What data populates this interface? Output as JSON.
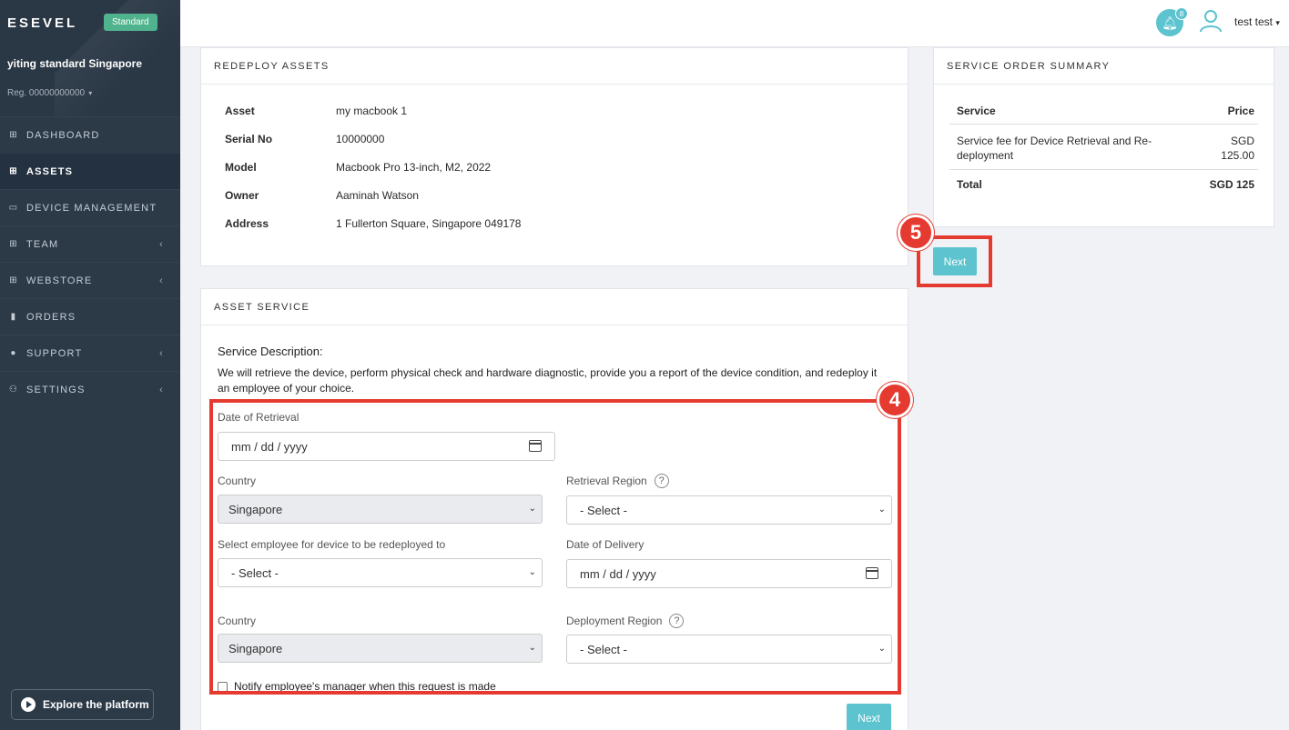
{
  "sidebar": {
    "brand": "ESEVEL",
    "plan_badge": "Standard",
    "org_name": "yiting standard Singapore",
    "org_reg": "Reg. 00000000000",
    "items": [
      {
        "label": "DASHBOARD",
        "icon": "grid-icon",
        "active": false,
        "has_chevron": false
      },
      {
        "label": "ASSETS",
        "icon": "grid-icon",
        "active": true,
        "has_chevron": false
      },
      {
        "label": "DEVICE MANAGEMENT",
        "icon": "laptop-icon",
        "active": false,
        "has_chevron": false
      },
      {
        "label": "TEAM",
        "icon": "grid-icon",
        "active": false,
        "has_chevron": true
      },
      {
        "label": "WEBSTORE",
        "icon": "grid-icon",
        "active": false,
        "has_chevron": true
      },
      {
        "label": "ORDERS",
        "icon": "document-icon",
        "active": false,
        "has_chevron": false
      },
      {
        "label": "SUPPORT",
        "icon": "info-icon",
        "active": false,
        "has_chevron": true
      },
      {
        "label": "SETTINGS",
        "icon": "users-icon",
        "active": false,
        "has_chevron": true
      }
    ],
    "explore_label": "Explore the platform"
  },
  "topbar": {
    "notification_count": "8",
    "user_name": "test test"
  },
  "redeploy": {
    "title": "REDEPLOY ASSETS",
    "rows": [
      {
        "label": "Asset",
        "value": "my macbook 1"
      },
      {
        "label": "Serial No",
        "value": "10000000"
      },
      {
        "label": "Model",
        "value": "Macbook Pro 13-inch, M2, 2022"
      },
      {
        "label": "Owner",
        "value": "Aaminah Watson"
      },
      {
        "label": "Address",
        "value": "1 Fullerton Square, Singapore 049178"
      }
    ]
  },
  "asset_service": {
    "title": "ASSET SERVICE",
    "desc_title": "Service Description:",
    "desc_text": "We will retrieve the device, perform physical check and hardware diagnostic, provide you a report of the device condition, and redeploy it an employee of your choice.",
    "date_retrieval_label": "Date of Retrieval",
    "date_retrieval_placeholder": "mm / dd / yyyy",
    "country1_label": "Country",
    "country1_value": "Singapore",
    "retrieval_region_label": "Retrieval Region",
    "retrieval_region_value": "- Select -",
    "employee_label": "Select employee for device to be redeployed to",
    "employee_value": "- Select -",
    "date_delivery_label": "Date of Delivery",
    "date_delivery_placeholder": "mm / dd / yyyy",
    "country2_label": "Country",
    "country2_value": "Singapore",
    "deployment_region_label": "Deployment Region",
    "deployment_region_value": "- Select -",
    "notify_label": "Notify employee's manager when this request is made",
    "next_label": "Next"
  },
  "summary": {
    "title": "SERVICE ORDER SUMMARY",
    "col_service": "Service",
    "col_price": "Price",
    "service_line1": "Service fee for Device Retrieval and Re-",
    "service_line2": "deployment",
    "price_line1": "SGD",
    "price_line2": "125.00",
    "total_label": "Total",
    "total_value": "SGD 125",
    "next_label": "Next"
  },
  "annotations": {
    "step4": "4",
    "step5": "5"
  },
  "colors": {
    "accent": "#5cc3cf",
    "sidebar": "#2c3a48",
    "annotation": "#e53a2f",
    "badge": "#4fb38d"
  }
}
